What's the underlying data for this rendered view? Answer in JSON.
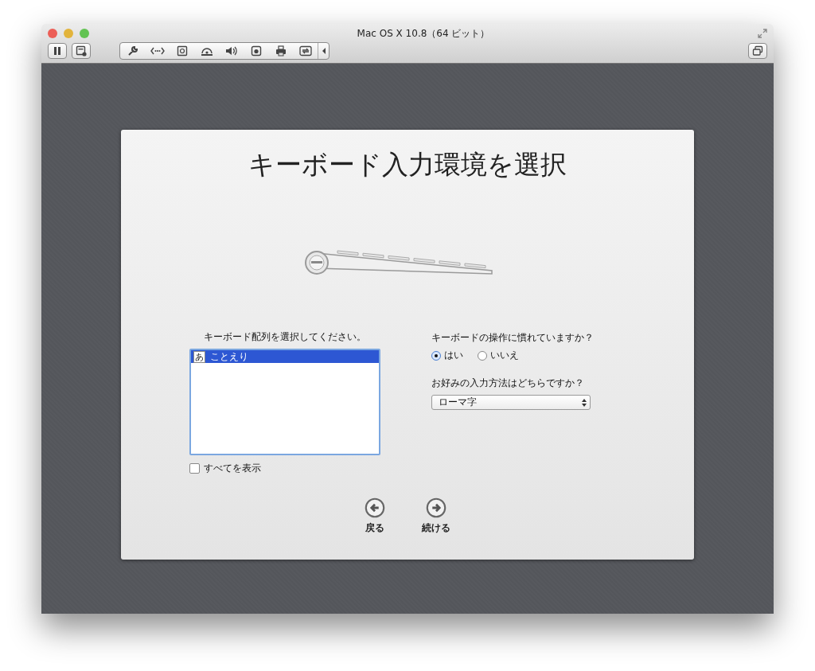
{
  "window": {
    "title": "Mac OS X 10.8（64 ビット）"
  },
  "panel": {
    "title": "キーボード入力環境を選択",
    "layout_list": {
      "label": "キーボード配列を選択してください。",
      "items": [
        {
          "badge": "あ",
          "label": "ことえり",
          "selected": true
        }
      ]
    },
    "show_all": {
      "label": "すべてを表示",
      "checked": false
    },
    "experience": {
      "question": "キーボードの操作に慣れていますか？",
      "options": [
        {
          "label": "はい",
          "selected": true
        },
        {
          "label": "いいえ",
          "selected": false
        }
      ]
    },
    "input_method": {
      "question": "お好みの入力方法はどちらですか？",
      "value": "ローマ字"
    },
    "nav": [
      {
        "kind": "back",
        "label": "戻る"
      },
      {
        "kind": "forward",
        "label": "続ける"
      }
    ]
  }
}
